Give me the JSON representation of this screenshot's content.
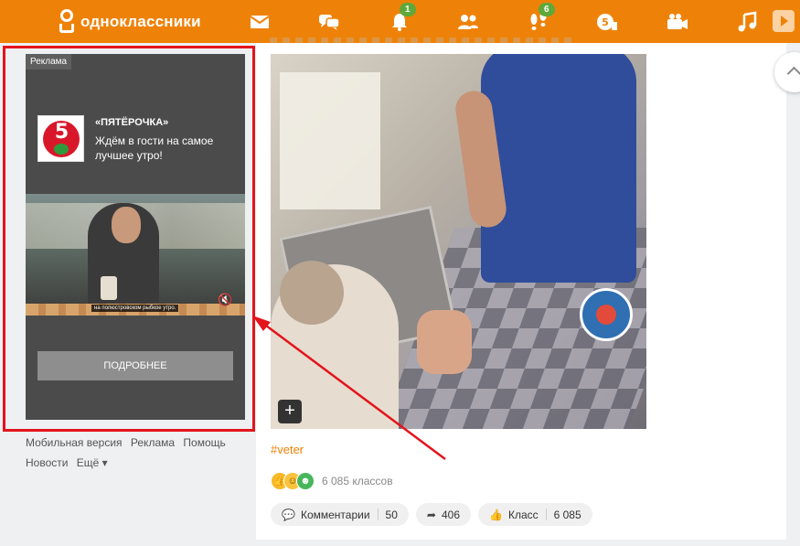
{
  "app": {
    "brand_name": "одноклассники",
    "accent_color": "#ee8208"
  },
  "topnav": {
    "icons": [
      {
        "name": "messages-icon"
      },
      {
        "name": "discussions-icon"
      },
      {
        "name": "notifications-icon",
        "badge": "1"
      },
      {
        "name": "friends-icon"
      },
      {
        "name": "guests-icon",
        "badge": "6"
      },
      {
        "name": "events-icon"
      },
      {
        "name": "video-icon"
      },
      {
        "name": "music-icon"
      }
    ]
  },
  "ad": {
    "label": "Реклама",
    "brand": "«ПЯТЁРОЧКА»",
    "logo_text": "5",
    "text": "Ждём в гости на самое лучшее утро!",
    "video_caption": "на полюстровском рыбкое утро.",
    "button": "ПОДРОБНЕЕ"
  },
  "footer": {
    "links": [
      "Мобильная версия",
      "Реклама",
      "Помощь",
      "Новости",
      "Ещё ▾"
    ]
  },
  "post": {
    "hashtag": "#veter",
    "reactions_text": "6 085 классов",
    "comments_label": "Комментарии",
    "comments_count": "50",
    "shares_count": "406",
    "likes_label": "Класс",
    "likes_count": "6 085"
  }
}
